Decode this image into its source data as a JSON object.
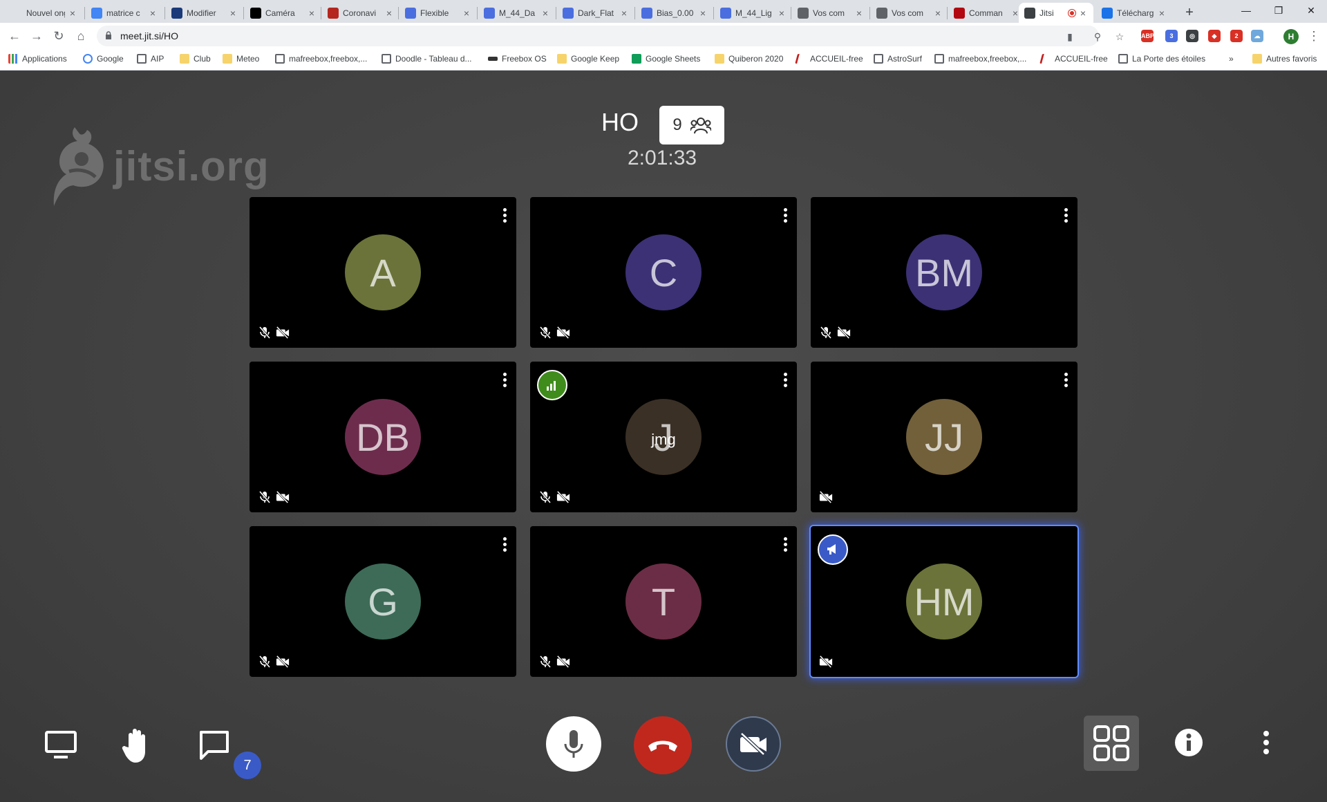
{
  "browser": {
    "tabs": [
      {
        "title": "Nouvel onglet",
        "favicon": "blank-icon",
        "color": "#dee1e6"
      },
      {
        "title": "matrice c",
        "favicon": "google-icon",
        "color": "#4285f4"
      },
      {
        "title": "Modifier",
        "favicon": "generic-icon",
        "color": "#1a3a7a"
      },
      {
        "title": "Caméra",
        "favicon": "camera-shop-icon",
        "color": "#000000"
      },
      {
        "title": "Coronavi",
        "favicon": "news-icon",
        "color": "#b5261e"
      },
      {
        "title": "Flexible",
        "favicon": "flexible-icon",
        "color": "#4a6ee0"
      },
      {
        "title": "M_44_Da",
        "favicon": "doc-icon",
        "color": "#4a6ee0"
      },
      {
        "title": "Dark_Flat",
        "favicon": "doc-icon",
        "color": "#4a6ee0"
      },
      {
        "title": "Bias_0.00",
        "favicon": "doc-icon",
        "color": "#4a6ee0"
      },
      {
        "title": "M_44_Lig",
        "favicon": "doc-icon",
        "color": "#4a6ee0"
      },
      {
        "title": "Vos com",
        "favicon": "globe-icon",
        "color": "#5f6368"
      },
      {
        "title": "Vos com",
        "favicon": "globe-icon",
        "color": "#5f6368"
      },
      {
        "title": "Comman",
        "favicon": "netflix-icon",
        "color": "#b20710"
      },
      {
        "title": "Jitsi",
        "favicon": "jitsi-icon",
        "color": "#3c4043",
        "active": true,
        "recording": true
      },
      {
        "title": "Télécharg",
        "favicon": "download-icon",
        "color": "#1a73e8"
      }
    ],
    "url": "meet.jit.si/HO",
    "bookmarks": [
      {
        "label": "Applications",
        "icon": "apps-grid-icon"
      },
      {
        "label": "Google",
        "icon": "google-icon"
      },
      {
        "label": "AIP",
        "icon": "globe-icon"
      },
      {
        "label": "Club",
        "icon": "folder-icon"
      },
      {
        "label": "Meteo",
        "icon": "folder-icon"
      },
      {
        "label": "mafreebox,freebox,...",
        "icon": "globe-icon"
      },
      {
        "label": "Doodle - Tableau d...",
        "icon": "globe-icon"
      },
      {
        "label": "Freebox OS",
        "icon": "freebox-icon"
      },
      {
        "label": "Google Keep",
        "icon": "folder-icon"
      },
      {
        "label": "Google Sheets",
        "icon": "sheets-icon"
      },
      {
        "label": "Quiberon 2020",
        "icon": "folder-icon"
      },
      {
        "label": "ACCUEIL-free",
        "icon": "free-icon"
      },
      {
        "label": "AstroSurf",
        "icon": "globe-icon"
      },
      {
        "label": "mafreebox,freebox,...",
        "icon": "globe-icon"
      },
      {
        "label": "ACCUEIL-free",
        "icon": "free-icon"
      },
      {
        "label": "La Porte des étoiles",
        "icon": "globe-icon"
      }
    ],
    "bookmarks_overflow": "»",
    "other_bookmarks": "Autres favoris",
    "extension_badges": [
      "3",
      "2"
    ],
    "profile_initial": "H"
  },
  "meeting": {
    "logo_text": "jitsi.org",
    "subject": "HO",
    "participant_count": "9",
    "timer": "2:01:33",
    "participants": [
      {
        "initials": "A",
        "color": "#6b733a",
        "audio_muted": true,
        "video_muted": true
      },
      {
        "initials": "C",
        "color": "#3c3175",
        "audio_muted": true,
        "video_muted": true
      },
      {
        "initials": "BM",
        "color": "#3c3175",
        "audio_muted": true,
        "video_muted": true
      },
      {
        "initials": "DB",
        "color": "#6e2c4d",
        "audio_muted": true,
        "video_muted": true
      },
      {
        "initials": "J",
        "color": "#3a3025",
        "audio_muted": true,
        "video_muted": true,
        "name_label": "jmg",
        "connection_indicator": true
      },
      {
        "initials": "JJ",
        "color": "#72603a",
        "audio_muted": false,
        "video_muted": true
      },
      {
        "initials": "G",
        "color": "#3d6b58",
        "audio_muted": true,
        "video_muted": true
      },
      {
        "initials": "T",
        "color": "#6b2d45",
        "audio_muted": true,
        "video_muted": true
      },
      {
        "initials": "HM",
        "color": "#6b733a",
        "audio_muted": false,
        "video_muted": true,
        "dominant_speaker": true
      }
    ],
    "chat_unread": "7",
    "colors": {
      "hangup": "#c0281e",
      "video_off_button": "#2f3a4d",
      "badge_blue": "#3a5bc7",
      "connection_good": "#3f8c1c"
    }
  }
}
